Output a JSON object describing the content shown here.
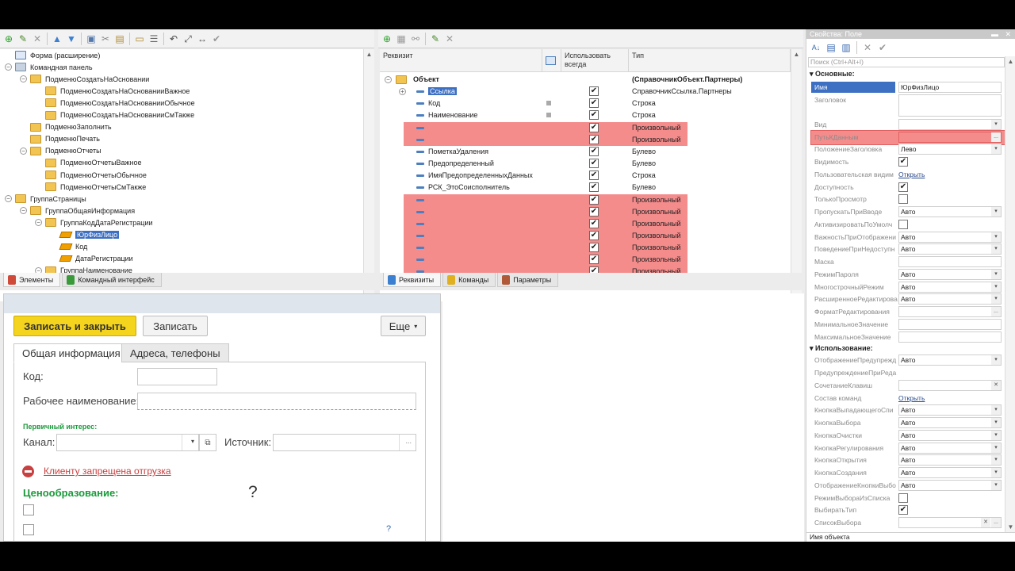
{
  "tree_panel": {
    "items": [
      {
        "label": "Форма (расширение)",
        "level": 0,
        "kind": "form"
      },
      {
        "label": "Командная панель",
        "level": 0,
        "kind": "cmd",
        "exp": "−"
      },
      {
        "label": "ПодменюСоздатьНаОсновании",
        "level": 1,
        "kind": "folder",
        "exp": "−"
      },
      {
        "label": "ПодменюСоздатьНаОснованииВажное",
        "level": 2,
        "kind": "folder"
      },
      {
        "label": "ПодменюСоздатьНаОснованииОбычное",
        "level": 2,
        "kind": "folder"
      },
      {
        "label": "ПодменюСоздатьНаОснованииСмТакже",
        "level": 2,
        "kind": "folder"
      },
      {
        "label": "ПодменюЗаполнить",
        "level": 1,
        "kind": "folder"
      },
      {
        "label": "ПодменюПечать",
        "level": 1,
        "kind": "folder"
      },
      {
        "label": "ПодменюОтчеты",
        "level": 1,
        "kind": "folder",
        "exp": "−"
      },
      {
        "label": "ПодменюОтчетыВажное",
        "level": 2,
        "kind": "folder"
      },
      {
        "label": "ПодменюОтчетыОбычное",
        "level": 2,
        "kind": "folder"
      },
      {
        "label": "ПодменюОтчетыСмТакже",
        "level": 2,
        "kind": "folder"
      },
      {
        "label": "ГруппаСтраницы",
        "level": 0,
        "kind": "folder",
        "exp": "−"
      },
      {
        "label": "ГруппаОбщаяИнформация",
        "level": 1,
        "kind": "folder",
        "exp": "−"
      },
      {
        "label": "ГруппаКодДатаРегистрации",
        "level": 2,
        "kind": "folder",
        "exp": "−"
      },
      {
        "label": "ЮрФизЛицо",
        "level": 3,
        "kind": "field",
        "selected": true
      },
      {
        "label": "Код",
        "level": 3,
        "kind": "field"
      },
      {
        "label": "ДатаРегистрации",
        "level": 3,
        "kind": "field"
      },
      {
        "label": "ГруппаНаименование",
        "level": 2,
        "kind": "folder",
        "exp": "−"
      }
    ],
    "tabs": [
      "Элементы",
      "Командный интерфейс"
    ]
  },
  "grid_panel": {
    "headers": {
      "col1": "Реквизит",
      "col2": "Использовать всегда",
      "col3": "Тип"
    },
    "rows": [
      {
        "name": "Объект",
        "type": "(СправочникОбъект.Партнеры)",
        "root": true,
        "check": false
      },
      {
        "name": "Ссылка",
        "type": "СправочникСсылка.Партнеры",
        "check": true,
        "selected": true
      },
      {
        "name": "Код",
        "type": "Строка",
        "check": true,
        "sq": true
      },
      {
        "name": "Наименование",
        "type": "Строка",
        "check": true,
        "sq": true
      },
      {
        "name": "",
        "type": "Произвольный",
        "check": true,
        "red": true
      },
      {
        "name": "",
        "type": "Произвольный",
        "check": true,
        "red": true
      },
      {
        "name": "ПометкаУдаления",
        "type": "Булево",
        "check": true
      },
      {
        "name": "Предопределенный",
        "type": "Булево",
        "check": true
      },
      {
        "name": "ИмяПредопределенныхДанных",
        "type": "Строка",
        "check": true
      },
      {
        "name": "РСК_ЭтоСоисполнитель",
        "type": "Булево",
        "check": true
      },
      {
        "name": "",
        "type": "Произвольный",
        "check": true,
        "red": true
      },
      {
        "name": "",
        "type": "Произвольный",
        "check": true,
        "red": true
      },
      {
        "name": "",
        "type": "Произвольный",
        "check": true,
        "red": true
      },
      {
        "name": "",
        "type": "Произвольный",
        "check": true,
        "red": true
      },
      {
        "name": "",
        "type": "Произвольный",
        "check": true,
        "red": true
      },
      {
        "name": "",
        "type": "Произвольный",
        "check": true,
        "red": true
      },
      {
        "name": "",
        "type": "Произвольный",
        "check": true,
        "red": true
      }
    ],
    "tabs": [
      "Реквизиты",
      "Команды",
      "Параметры"
    ]
  },
  "props_panel": {
    "title": "Свойства: Поле",
    "search_placeholder": "Поиск (Ctrl+Alt+I)",
    "section_main": "Основные:",
    "section_use": "Использование:",
    "rows_main": [
      {
        "label": "Имя",
        "value": "ЮрФизЛицо",
        "kind": "text",
        "name_row": true
      },
      {
        "label": "Заголовок",
        "value": "",
        "kind": "tall"
      },
      {
        "label": "Вид",
        "value": "",
        "kind": "dd"
      },
      {
        "label": "ПутьКДанным",
        "value": "",
        "kind": "dots",
        "red": true
      },
      {
        "label": "ПоложениеЗаголовка",
        "value": "Лево",
        "kind": "dd"
      },
      {
        "label": "Видимость",
        "kind": "check",
        "checked": true
      },
      {
        "label": "Пользовательская видим",
        "kind": "link",
        "value": "Открыть"
      },
      {
        "label": "Доступность",
        "kind": "check",
        "checked": true
      },
      {
        "label": "ТолькоПросмотр",
        "kind": "check",
        "checked": false
      },
      {
        "label": "ПропускатьПриВводе",
        "value": "Авто",
        "kind": "dd"
      },
      {
        "label": "АктивизироватьПоУмолч",
        "kind": "check",
        "checked": false
      },
      {
        "label": "ВажностьПриОтображени",
        "value": "Авто",
        "kind": "dd"
      },
      {
        "label": "ПоведениеПриНедоступн",
        "value": "Авто",
        "kind": "dd"
      },
      {
        "label": "Маска",
        "value": "",
        "kind": "text"
      },
      {
        "label": "РежимПароля",
        "value": "Авто",
        "kind": "dd"
      },
      {
        "label": "МногострочныйРежим",
        "value": "Авто",
        "kind": "dd"
      },
      {
        "label": "РасширенноеРедактирова",
        "value": "Авто",
        "kind": "dd"
      },
      {
        "label": "ФорматРедактирования",
        "value": "",
        "kind": "dots"
      },
      {
        "label": "МинимальноеЗначение",
        "value": "",
        "kind": "text"
      },
      {
        "label": "МаксимальноеЗначение",
        "value": "",
        "kind": "text"
      }
    ],
    "rows_use": [
      {
        "label": "ОтображениеПредупрежд",
        "value": "Авто",
        "kind": "dd"
      },
      {
        "label": "ПредупреждениеПриРеда",
        "value": "",
        "kind": "none"
      },
      {
        "label": "СочетаниеКлавиш",
        "value": "",
        "kind": "x"
      },
      {
        "label": "Состав команд",
        "kind": "link",
        "value": "Открыть"
      },
      {
        "label": "КнопкаВыпадающегоСпи",
        "value": "Авто",
        "kind": "dd"
      },
      {
        "label": "КнопкаВыбора",
        "value": "Авто",
        "kind": "dd"
      },
      {
        "label": "КнопкаОчистки",
        "value": "Авто",
        "kind": "dd"
      },
      {
        "label": "КнопкаРегулирования",
        "value": "Авто",
        "kind": "dd"
      },
      {
        "label": "КнопкаОткрытия",
        "value": "Авто",
        "kind": "dd"
      },
      {
        "label": "КнопкаСоздания",
        "value": "Авто",
        "kind": "dd"
      },
      {
        "label": "ОтображениеКнопкиВыбо",
        "value": "Авто",
        "kind": "dd"
      },
      {
        "label": "РежимВыбораИзСписка",
        "kind": "check",
        "checked": false
      },
      {
        "label": "ВыбиратьТип",
        "kind": "check",
        "checked": true
      },
      {
        "label": "СписокВыбора",
        "value": "",
        "kind": "dotsx"
      }
    ],
    "footer": "Имя объекта"
  },
  "form_preview": {
    "save_close": "Записать и закрыть",
    "save": "Записать",
    "more": "Еще",
    "tab_general": "Общая информация",
    "tab_address": "Адреса, телефоны",
    "code_label": "Код:",
    "work_name_label": "Рабочее наименование:",
    "primary_interest": "Первичный интерес:",
    "channel_label": "Канал:",
    "source_label": "Источник:",
    "shipment_ban": "Клиенту запрещена отгрузка",
    "pricing": "Ценообразование:",
    "question_big": "?",
    "question_small": "?"
  },
  "colors": {
    "red_highlight": "#f58c8c",
    "selection": "#3d6fc2",
    "primary_button": "#f5d41e",
    "green_label": "#1a9a3a",
    "ban_red": "#c84040"
  }
}
